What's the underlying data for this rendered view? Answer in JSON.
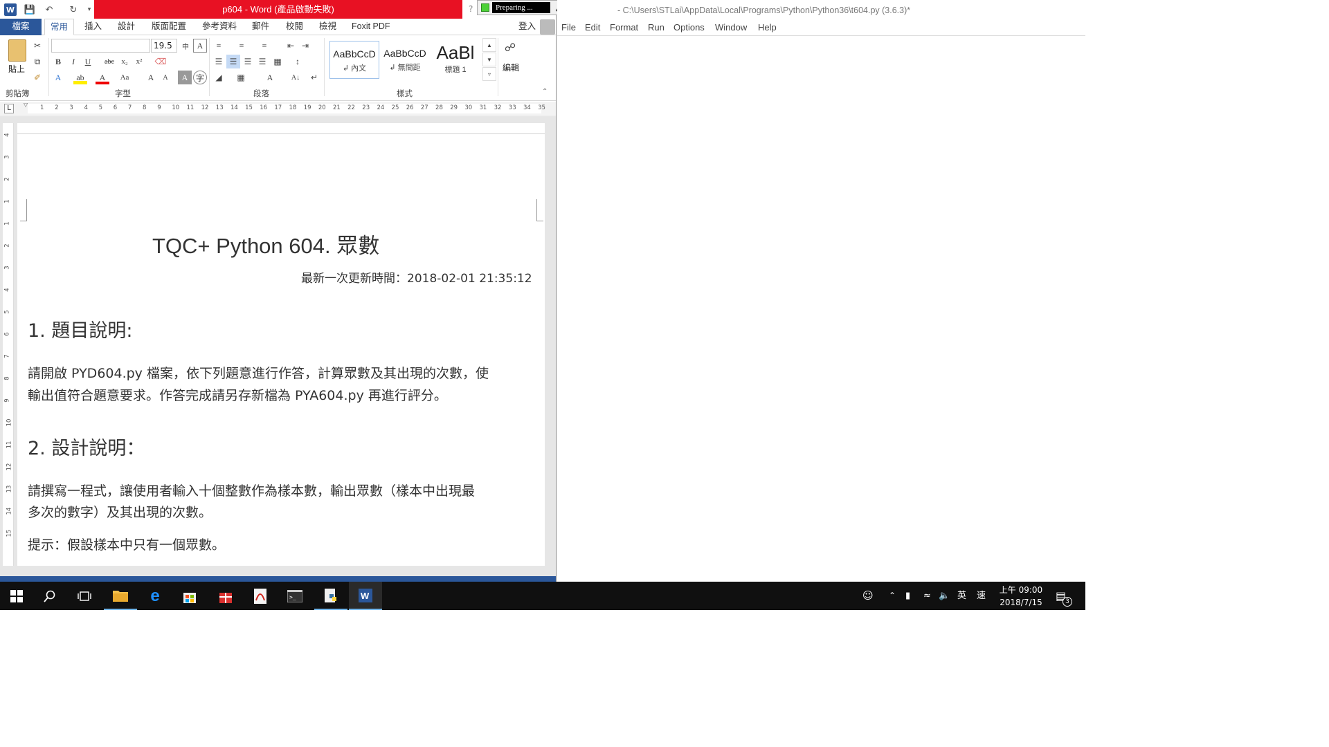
{
  "word": {
    "title": "p604 - Word (產品啟動失敗)",
    "tabs": [
      "檔案",
      "常用",
      "插入",
      "設計",
      "版面配置",
      "參考資料",
      "郵件",
      "校閱",
      "檢視",
      "Foxit PDF"
    ],
    "signin": "登入",
    "ribbon": {
      "paste": "貼上",
      "font_size": "19.5",
      "font_name": "",
      "groups": [
        "剪貼簿",
        "字型",
        "段落",
        "樣式",
        "編輯"
      ],
      "edit_label": "編輯",
      "styles": [
        {
          "sample": "AaBbCcD",
          "name": "↲ 內文"
        },
        {
          "sample": "AaBbCcD",
          "name": "↲ 無間距"
        },
        {
          "sample": "AaBl",
          "name": "標題 1"
        }
      ]
    },
    "ruler_ticks": [
      "1",
      "2",
      "3",
      "4",
      "5",
      "6",
      "7",
      "8",
      "9",
      "10",
      "11",
      "12",
      "13",
      "14",
      "15",
      "16",
      "17",
      "18",
      "19",
      "20",
      "21",
      "22",
      "23",
      "24",
      "25",
      "26",
      "27",
      "28",
      "29",
      "30",
      "31",
      "32",
      "33",
      "34",
      "35"
    ],
    "vruler_ticks": [
      "4",
      "3",
      "2",
      "1",
      "1",
      "2",
      "3",
      "4",
      "5",
      "6",
      "7",
      "8",
      "9",
      "10",
      "11",
      "12",
      "13",
      "14",
      "15"
    ],
    "document": {
      "title": "TQC+ Python 604. 眾數",
      "updated": "最新一次更新時間：2018-02-01 21:35:12",
      "h1": "1.  題目說明:",
      "p1_line1": "請開啟 PYD604.py 檔案，依下列題意進行作答，計算眾數及其出現的次數，使",
      "p1_line2": "輸出值符合題意要求。作答完成請另存新檔為 PYA604.py 再進行評分。",
      "h2": "2.  設計說明：",
      "p2_line1": "請撰寫一程式，讓使用者輸入十個整數作為樣本數，輸出眾數（樣本中出現最",
      "p2_line2": "多次的數字）及其出現的次數。",
      "p3": "提示：假設樣本中只有一個眾數。"
    }
  },
  "recorder": {
    "status": "Preparing ..."
  },
  "idle": {
    "title": "- C:\\Users\\STLai\\AppData\\Local\\Programs\\Python\\Python36\\t604.py (3.6.3)*",
    "menu": [
      "File",
      "Edit",
      "Format",
      "Run",
      "Options",
      "Window",
      "Help"
    ]
  },
  "taskbar": {
    "icons": [
      "windows-start-icon",
      "search-icon",
      "task-view-icon",
      "file-explorer-icon",
      "edge-icon",
      "store-icon",
      "gift-icon",
      "pdf-icon",
      "cmd-icon",
      "python-icon",
      "word-icon"
    ],
    "ime": "英",
    "ime2": "速",
    "time": "上午 09:00",
    "date": "2018/7/15",
    "notifications": "3"
  },
  "colors": {
    "word_blue": "#2b579a",
    "title_red": "#e81123",
    "taskbar": "#101010"
  }
}
